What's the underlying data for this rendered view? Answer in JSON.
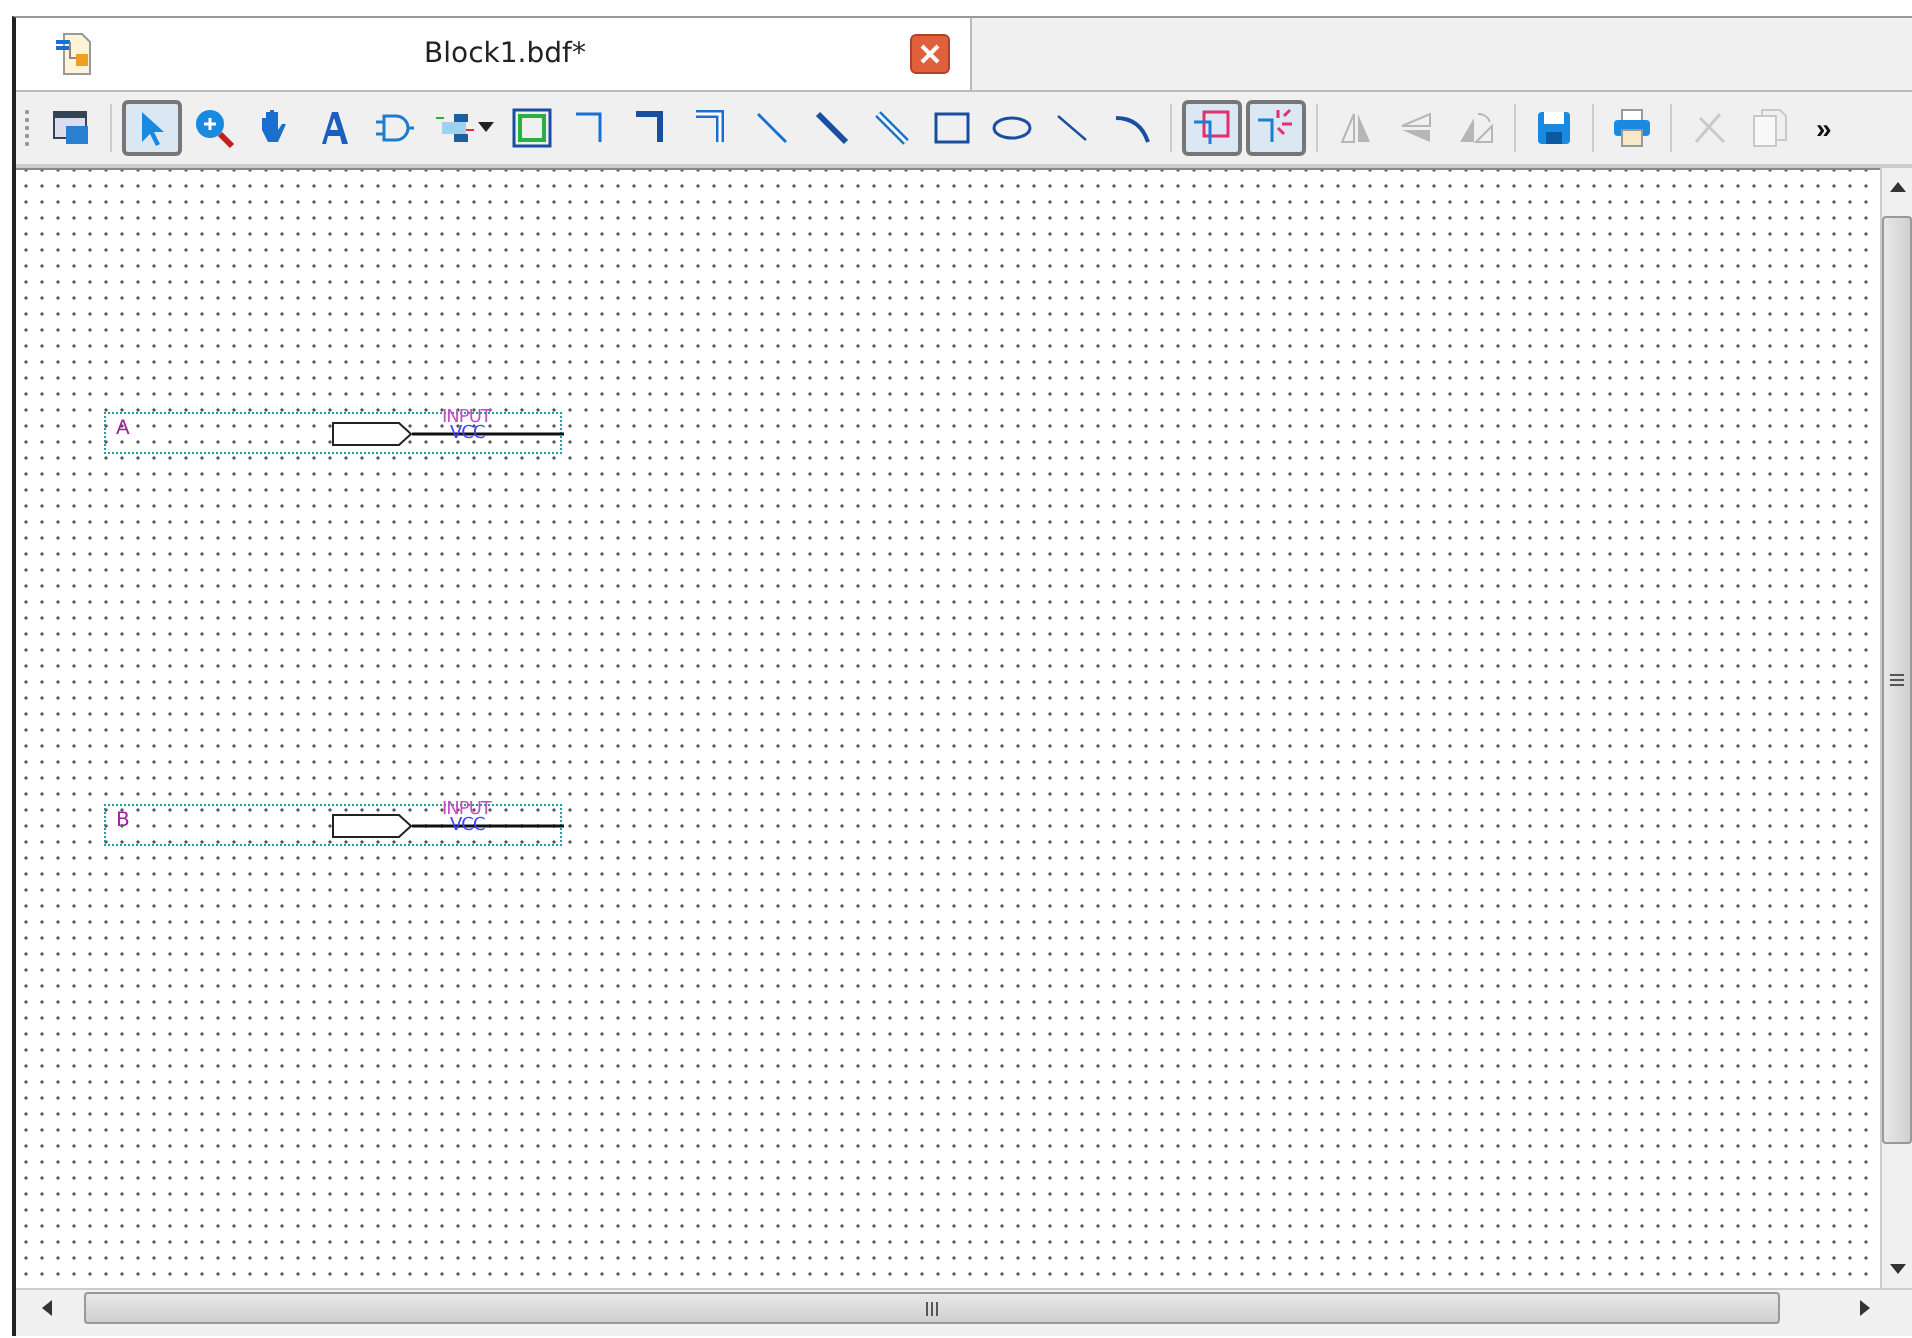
{
  "tab": {
    "title": "Block1.bdf*",
    "selected": true
  },
  "toolbar": {
    "groups": [
      [
        {
          "kind": "detach",
          "selected": false,
          "disabled": false
        }
      ],
      [
        {
          "kind": "select",
          "selected": true,
          "disabled": false
        },
        {
          "kind": "zoom",
          "selected": false,
          "disabled": false
        },
        {
          "kind": "hand",
          "selected": false,
          "disabled": false
        },
        {
          "kind": "text",
          "selected": false,
          "disabled": false
        },
        {
          "kind": "symbol",
          "selected": false,
          "disabled": false
        },
        {
          "kind": "pin",
          "selected": false,
          "disabled": false
        },
        {
          "kind": "block",
          "selected": false,
          "disabled": false
        },
        {
          "kind": "ortho-node",
          "selected": false,
          "disabled": false
        },
        {
          "kind": "ortho-bus",
          "selected": false,
          "disabled": false
        },
        {
          "kind": "ortho-conduit",
          "selected": false,
          "disabled": false
        },
        {
          "kind": "diag-node",
          "selected": false,
          "disabled": false
        },
        {
          "kind": "diag-bus",
          "selected": false,
          "disabled": false
        },
        {
          "kind": "diag-conduit",
          "selected": false,
          "disabled": false
        },
        {
          "kind": "rect",
          "selected": false,
          "disabled": false
        },
        {
          "kind": "ellipse",
          "selected": false,
          "disabled": false
        },
        {
          "kind": "line",
          "selected": false,
          "disabled": false
        },
        {
          "kind": "arc",
          "selected": false,
          "disabled": false
        }
      ],
      [
        {
          "kind": "rubber",
          "selected": true,
          "disabled": false
        },
        {
          "kind": "partial",
          "selected": true,
          "disabled": false
        }
      ],
      [
        {
          "kind": "flip-h",
          "selected": false,
          "disabled": true
        },
        {
          "kind": "flip-v",
          "selected": false,
          "disabled": true
        },
        {
          "kind": "rotate",
          "selected": false,
          "disabled": true
        }
      ],
      [
        {
          "kind": "save",
          "selected": false,
          "disabled": false
        }
      ],
      [
        {
          "kind": "print",
          "selected": false,
          "disabled": false
        }
      ],
      [
        {
          "kind": "cut",
          "selected": false,
          "disabled": true
        },
        {
          "kind": "copy",
          "selected": false,
          "disabled": true
        }
      ]
    ],
    "overflow": "»"
  },
  "pins": [
    {
      "name": "A",
      "type_label": "INPUT",
      "default_label": "VCC"
    },
    {
      "name": "B",
      "type_label": "INPUT",
      "default_label": "VCC"
    }
  ]
}
